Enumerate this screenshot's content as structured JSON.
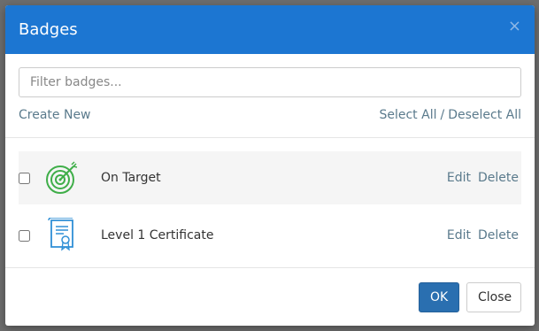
{
  "dialog": {
    "title": "Badges",
    "close_glyph": "×"
  },
  "filter": {
    "placeholder": "Filter badges...",
    "value": ""
  },
  "links": {
    "create_new": "Create New",
    "select_all": "Select All",
    "separator": "/",
    "deselect_all": "Deselect All"
  },
  "badges": [
    {
      "label": "On Target",
      "icon": "target-icon",
      "checked": false,
      "edit": "Edit",
      "delete": "Delete"
    },
    {
      "label": "Level 1 Certificate",
      "icon": "certificate-icon",
      "checked": false,
      "edit": "Edit",
      "delete": "Delete"
    }
  ],
  "footer": {
    "ok_label": "OK",
    "close_label": "Close"
  },
  "colors": {
    "header": "#1c76d2",
    "ok_button": "#2a6fb0",
    "link": "#5a7a8c",
    "target_icon": "#3fae49",
    "certificate_icon": "#2f8fd6"
  }
}
